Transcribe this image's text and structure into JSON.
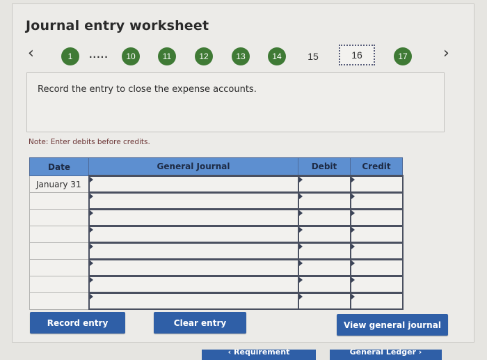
{
  "header": {
    "title": "Journal entry worksheet"
  },
  "pagination": {
    "prev_icon": "‹",
    "next_icon": "›",
    "ellipsis": ".....",
    "steps": [
      {
        "label": "1",
        "state": "completed"
      },
      {
        "label": "10",
        "state": "completed"
      },
      {
        "label": "11",
        "state": "completed"
      },
      {
        "label": "12",
        "state": "completed"
      },
      {
        "label": "13",
        "state": "completed"
      },
      {
        "label": "14",
        "state": "completed"
      },
      {
        "label": "15",
        "state": "incomplete"
      },
      {
        "label": "16",
        "state": "current"
      },
      {
        "label": "17",
        "state": "completed"
      }
    ]
  },
  "prompt": {
    "text": "Record the entry to close the expense accounts."
  },
  "note": "Note: Enter debits before credits.",
  "journal_table": {
    "columns": [
      "Date",
      "General Journal",
      "Debit",
      "Credit"
    ],
    "rows": [
      {
        "date": "January 31",
        "account": "",
        "debit": "",
        "credit": ""
      },
      {
        "date": "",
        "account": "",
        "debit": "",
        "credit": ""
      },
      {
        "date": "",
        "account": "",
        "debit": "",
        "credit": ""
      },
      {
        "date": "",
        "account": "",
        "debit": "",
        "credit": ""
      },
      {
        "date": "",
        "account": "",
        "debit": "",
        "credit": ""
      },
      {
        "date": "",
        "account": "",
        "debit": "",
        "credit": ""
      },
      {
        "date": "",
        "account": "",
        "debit": "",
        "credit": ""
      },
      {
        "date": "",
        "account": "",
        "debit": "",
        "credit": ""
      }
    ]
  },
  "buttons": {
    "record": "Record entry",
    "clear": "Clear entry",
    "view_journal": "View general journal"
  },
  "bottom_nav": {
    "prev": "‹  Requirement",
    "next": "General Ledger  ›"
  },
  "colors": {
    "step_completed": "#3f7a35",
    "button": "#2f5fa7",
    "table_header": "#5d8fd0",
    "note": "#6b3434"
  }
}
